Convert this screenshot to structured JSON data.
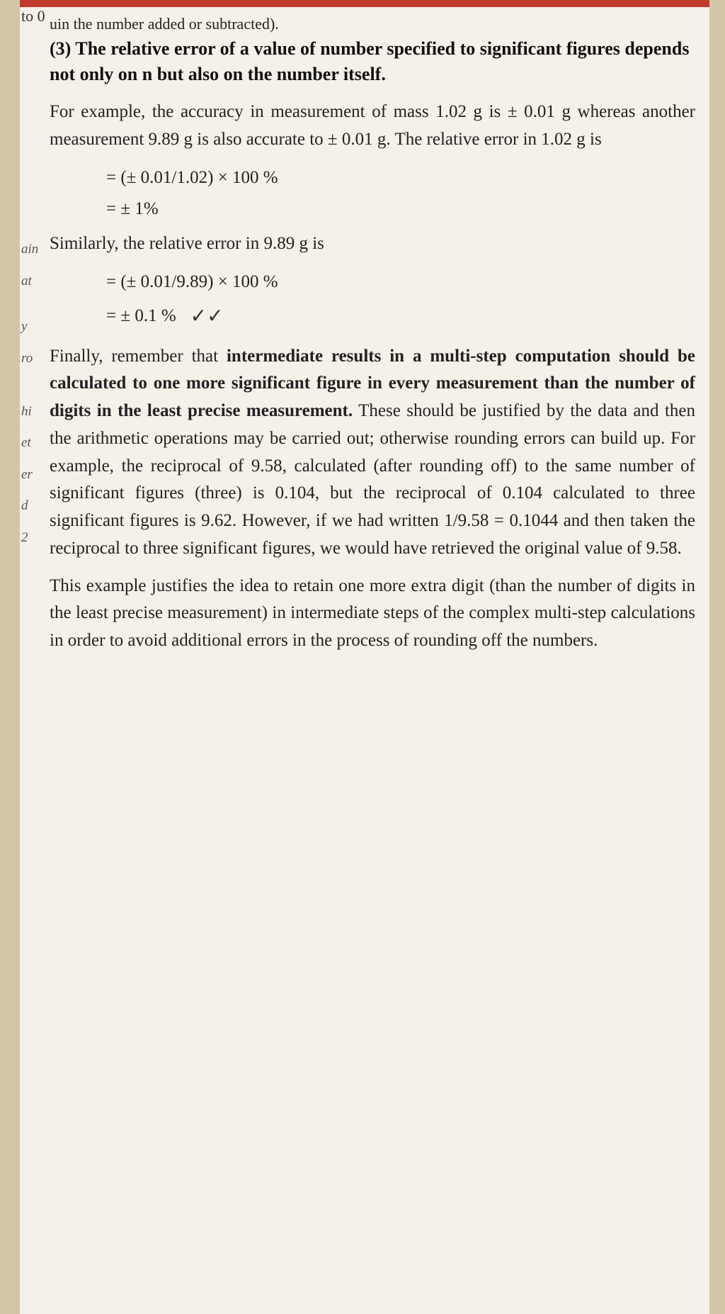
{
  "page": {
    "top_note": "uin the number added or subtracted).",
    "left_margin_labels": [
      "ain",
      "at",
      "y",
      "ro",
      "hi",
      "et",
      "er",
      "d",
      "2"
    ],
    "section3": {
      "heading": "(3) The relative error of a value of number specified to significant figures depends not only on n but also on the number itself.",
      "paragraph1": "For example,  the accuracy  in measurement of mass 1.02 g is ± 0.01 g  whereas another measurement 9.89 g is also accurate to ± 0.01 g. The relative error in 1.02 g is",
      "math1a": "= (± 0.01/1.02) × 100 %",
      "math1b": "= ± 1%",
      "paragraph2": "Similarly, the relative error in 9.89 g  is",
      "math2a": "= (± 0.01/9.89) × 100 %",
      "math2b": "= ± 0.1 %",
      "paragraph3_part1": "Finally, remember that ",
      "paragraph3_bold": "intermediate results in a multi-step computation should be calculated to one more significant figure in every measurement than the number of digits in the least precise measurement.",
      "paragraph3_part2": " These should be justified by the data and then the arithmetic operations may be carried out; otherwise rounding errors can build up. For example, the reciprocal of 9.58, calculated (after rounding off) to the same number of significant figures (three) is 0.104, but the reciprocal of 0.104 calculated to three significant figures is 9.62. However, if we had written 1/9.58 = 0.1044 and then taken the reciprocal to three significant figures, we would have retrieved the original value of 9.58.",
      "paragraph4": "  This example justifies the idea to retain one more extra digit (than the number of digits in the least precise measurement) in intermediate steps of the complex multi-step calculations in order to avoid additional errors in the process of rounding off the numbers."
    }
  }
}
